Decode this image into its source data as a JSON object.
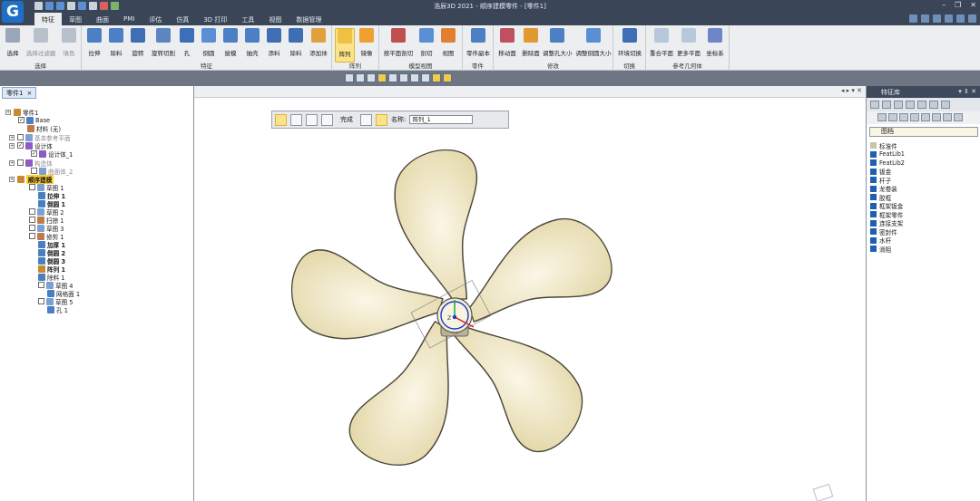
{
  "app": {
    "logo_letter": "G",
    "window_title": "浩辰3D 2021 - 顺序建模零件 - [零件1]"
  },
  "menu": {
    "tabs": [
      "特征",
      "草图",
      "曲面",
      "PMI",
      "评估",
      "仿真",
      "3D 打印",
      "工具",
      "视图",
      "数据管理"
    ],
    "active_tab": "特征"
  },
  "ribbon": {
    "select_group": {
      "name": "选择",
      "buttons": [
        "选择",
        "选择过滤器",
        "填色"
      ]
    },
    "feature_group": {
      "name": "特征",
      "buttons": [
        "拉伸",
        "除料",
        "旋转",
        "旋转切削",
        "孔",
        "倒圆",
        "拔模",
        "抽壳",
        "添料",
        "除料",
        "添加体"
      ]
    },
    "pattern_group": {
      "name": "阵列",
      "buttons": [
        "阵列",
        "镜像"
      ]
    },
    "model_view_group": {
      "name": "模型视图",
      "buttons": [
        "按平面剖切",
        "剖切",
        "视图"
      ]
    },
    "part_group": {
      "name": "零件",
      "buttons": [
        "零件副本"
      ]
    },
    "modify_group": {
      "name": "修改",
      "buttons": [
        "移动面",
        "删除面",
        "调整孔大小",
        "调整倒圆大小"
      ]
    },
    "switch_group": {
      "name": "切换",
      "buttons": [
        "环境切换"
      ]
    },
    "ref_group": {
      "name": "参考几何体",
      "buttons": [
        "重合平面",
        "更多平面",
        "坐标系"
      ]
    }
  },
  "left_panel": {
    "doc_tab": "零件1",
    "tree": [
      {
        "label": "零件1",
        "icon": "part",
        "checked": null
      },
      {
        "label": "Base",
        "icon": "body",
        "checked": true
      },
      {
        "label": "材料 (无)",
        "icon": "material",
        "checked": null
      },
      {
        "label": "基本参考平面",
        "icon": "planes",
        "checked": false
      },
      {
        "label": "设计体",
        "icon": "design-body",
        "checked": true
      },
      {
        "label": "设计体_1",
        "icon": "design-body",
        "checked": true
      },
      {
        "label": "构造体",
        "icon": "construction-body",
        "checked": false
      },
      {
        "label": "曲面体_2",
        "icon": "surface-body",
        "checked": false
      },
      {
        "label": "顺序建模",
        "icon": "ordered",
        "checked": null
      },
      {
        "label": "草图 1",
        "icon": "sketch",
        "checked": false
      },
      {
        "label": "拉伸 1",
        "icon": "feature",
        "checked": null
      },
      {
        "label": "倒圆 1",
        "icon": "feature",
        "checked": null
      },
      {
        "label": "草图 2",
        "icon": "sketch",
        "checked": false
      },
      {
        "label": "扫掠 1",
        "icon": "sweep",
        "checked": false
      },
      {
        "label": "草图 3",
        "icon": "sketch",
        "checked": false
      },
      {
        "label": "修剪 1",
        "icon": "trim",
        "checked": false
      },
      {
        "label": "加厚 1",
        "icon": "feature",
        "checked": null
      },
      {
        "label": "倒圆 2",
        "icon": "feature",
        "checked": null
      },
      {
        "label": "倒圆 3",
        "icon": "feature",
        "checked": null
      },
      {
        "label": "阵列 1",
        "icon": "pattern",
        "checked": null
      },
      {
        "label": "除料 1",
        "icon": "feature",
        "checked": null
      },
      {
        "label": "草图 4",
        "icon": "sketch",
        "checked": false
      },
      {
        "label": "网格面 1",
        "icon": "mesh",
        "checked": null
      },
      {
        "label": "草图 5",
        "icon": "sketch",
        "checked": false
      },
      {
        "label": "孔 1",
        "icon": "hole",
        "checked": null
      }
    ]
  },
  "command_bar": {
    "finish_label": "完成",
    "name_label": "名称:",
    "name_value": "阵列_1"
  },
  "right_panel": {
    "title": "特征库",
    "library_selector": "图档",
    "items": [
      "标准件",
      "FeatLib1",
      "FeatLib2",
      "钣金",
      "杆子",
      "龙卷装",
      "胶框",
      "框架钣金",
      "框架零件",
      "连接支架",
      "密封件",
      "水杆",
      "滑阻"
    ]
  },
  "colors": {
    "blade_fill": "#e6dcb2",
    "blade_highlight": "#fbf7e7",
    "accent_blue": "#1f6fc8",
    "selection_yellow": "#ffcc33"
  }
}
